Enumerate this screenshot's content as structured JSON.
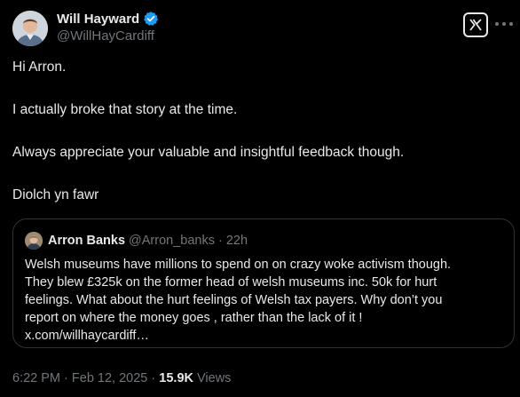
{
  "author": {
    "name": "Will Hayward",
    "handle": "@WillHayCardiff",
    "verified": true
  },
  "icons": {
    "verified": "verified-badge-icon",
    "logo": "x-logo-icon",
    "more": "more-icon"
  },
  "tweet": {
    "paragraphs": [
      "Hi Arron.",
      "I actually broke that story at the time.",
      "Always appreciate your valuable and insightful feedback though.",
      "Diolch yn fawr"
    ]
  },
  "quote": {
    "name": "Arron Banks",
    "handle": "@Arron_banks",
    "dot": "·",
    "time": "22h",
    "lines": [
      "Welsh museums have millions to spend on on crazy woke activism though.",
      "They blew £325k on the former head of welsh museums inc. 50k for hurt",
      "feelings. What about the hurt feelings of Welsh tax payers. Why don’t you",
      "report on where the money goes , rather than the lack of it !",
      "x.com/willhaycardiff…"
    ]
  },
  "meta": {
    "time": "6:22 PM",
    "sep": "·",
    "date": "Feb 12, 2025",
    "views_count": "15.9K",
    "views_label": "Views"
  },
  "colors": {
    "background": "#000000",
    "text": "#e7e9ea",
    "secondary": "#71767b",
    "verified": "#1d9bf0",
    "border": "#2f3336"
  }
}
